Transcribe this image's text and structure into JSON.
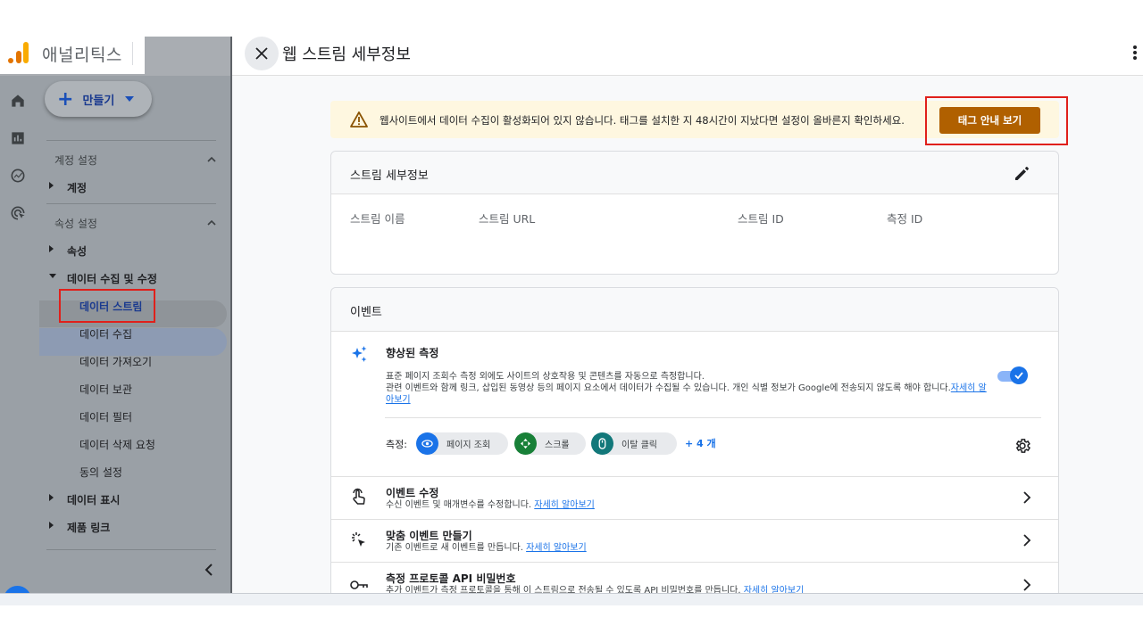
{
  "app": {
    "name": "애널리틱스",
    "create_label": "만들기"
  },
  "nav": {
    "account_section": "계정 설정",
    "account_item": "계정",
    "property_section": "속성 설정",
    "property_item": "속성",
    "data_group": "데이터 수집 및 수정",
    "data_items": [
      "데이터 스트림",
      "데이터 수집",
      "데이터 가져오기",
      "데이터 보관",
      "데이터 필터",
      "데이터 삭제 요청",
      "동의 설정"
    ],
    "data_display": "데이터 표시",
    "product_links": "제품 링크"
  },
  "panel": {
    "title": "웹 스트림 세부정보",
    "alert_text": "웹사이트에서 데이터 수집이 활성화되어 있지 않습니다. 태그를 설치한 지 48시간이 지났다면 설정이 올바른지 확인하세요.",
    "alert_button": "태그 안내 보기",
    "stream_card": {
      "title": "스트림 세부정보",
      "columns": [
        "스트림 이름",
        "스트림 URL",
        "스트림 ID",
        "측정 ID"
      ]
    },
    "events_card": {
      "title": "이벤트",
      "enhanced": {
        "title": "향상된 측정",
        "line1": "표준 페이지 조회수 측정 외에도 사이트의 상호작용 및 콘텐츠를 자동으로 측정합니다.",
        "line2": "관련 이벤트와 함께 링크, 삽입된 동영상 등의 페이지 요소에서 데이터가 수집될 수 있습니다. 개인 식별 정보가 Google에 전송되지 않도록 해야 합니다.",
        "link": "자세히 알아보기",
        "toggle_on": true
      },
      "measure_label": "측정:",
      "chips": [
        {
          "label": "페이지 조회",
          "icon": "eye-icon",
          "color": "#1a73e8"
        },
        {
          "label": "스크롤",
          "icon": "scroll-icon",
          "color": "#188038"
        },
        {
          "label": "이탈 클릭",
          "icon": "mouse-icon",
          "color": "#12787a"
        }
      ],
      "more_label": "+ 4 개",
      "rows": [
        {
          "title": "이벤트 수정",
          "desc": "수신 이벤트 및 매개변수를 수정합니다.",
          "link": "자세히 알아보기",
          "icon": "touch-icon"
        },
        {
          "title": "맞춤 이벤트 만들기",
          "desc": "기존 이벤트로 새 이벤트를 만듭니다.",
          "link": "자세히 알아보기",
          "icon": "click-sparkle-icon"
        },
        {
          "title": "측정 프로토콜 API 비밀번호",
          "desc": "추가 이벤트가 측정 프로토콜을 통해 이 스트림으로 전송될 수 있도록 API 비밀번호를 만듭니다.",
          "link": "자세히 알아보기",
          "icon": "key-icon"
        }
      ]
    }
  },
  "colors": {
    "accent": "#1a73e8",
    "warning_bg": "#fef7e0",
    "warning_button": "#b06000",
    "highlight_box": "#e0201b"
  }
}
